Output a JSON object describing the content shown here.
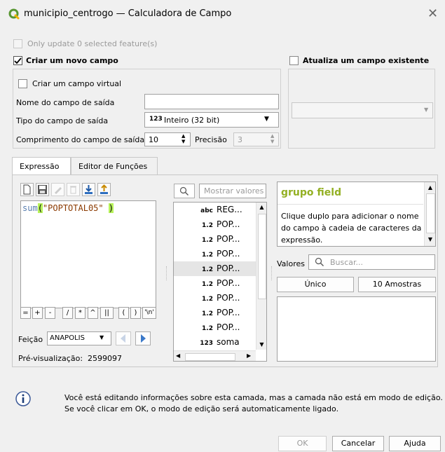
{
  "window": {
    "title": "municipio_centrogo — Calculadora de Campo"
  },
  "only_update": {
    "label": "Only update 0 selected feature(s)"
  },
  "create_field": {
    "label": "Criar um novo campo",
    "virtual_label": "Criar um campo virtual",
    "output_name_label": "Nome do campo de saída",
    "output_name_value": "",
    "output_type_label": "Tipo do campo de saída",
    "output_type_badge": "123",
    "output_type_value": "Inteiro (32 bit)",
    "output_length_label": "Comprimento do campo de saída",
    "output_length_value": "10",
    "precision_label": "Precisão",
    "precision_value": "3"
  },
  "update_field": {
    "label": "Atualiza um campo existente"
  },
  "tabs": [
    {
      "label": "Expressão"
    },
    {
      "label": "Editor de Funções"
    }
  ],
  "expression": {
    "func": "sum",
    "open": "(",
    "arg": "\"POPTOTAL05\"",
    "close": ")"
  },
  "operators": [
    "=",
    "+",
    "-",
    "/",
    "*",
    "^",
    "||",
    "(",
    ")",
    "'\\n'"
  ],
  "feature": {
    "label": "Feição",
    "value": "ANAPOLIS"
  },
  "preview": {
    "label": "Pré-visualização:",
    "value": "2599097"
  },
  "search": {
    "placeholder": "Mostrar valores"
  },
  "fields": [
    {
      "type": "abc",
      "name": "REG..."
    },
    {
      "type": "1.2",
      "name": "POP..."
    },
    {
      "type": "1.2",
      "name": "POP..."
    },
    {
      "type": "1.2",
      "name": "POP..."
    },
    {
      "type": "1.2",
      "name": "POP..."
    },
    {
      "type": "1.2",
      "name": "POP..."
    },
    {
      "type": "1.2",
      "name": "POP..."
    },
    {
      "type": "1.2",
      "name": "POP..."
    },
    {
      "type": "1.2",
      "name": "POP..."
    },
    {
      "type": "123",
      "name": "soma"
    }
  ],
  "help": {
    "title": "grupo field",
    "text": "Clique duplo para adicionar o nome do campo à cadeia de caracteres da expressão."
  },
  "values": {
    "label": "Valores",
    "search_placeholder": "Buscar...",
    "unique_label": "Único",
    "sample_label": "10 Amostras"
  },
  "info": {
    "line1": "Você está editando informações sobre esta camada, mas a camada não está em modo de edição.",
    "line2": "Se você clicar em OK, o modo de edição será automaticamente ligado."
  },
  "buttons": {
    "ok": "OK",
    "cancel": "Cancelar",
    "help": "Ajuda"
  },
  "colors": {
    "accent": "#589632",
    "highlight": "#b7f25a",
    "help_title": "#93b023"
  }
}
